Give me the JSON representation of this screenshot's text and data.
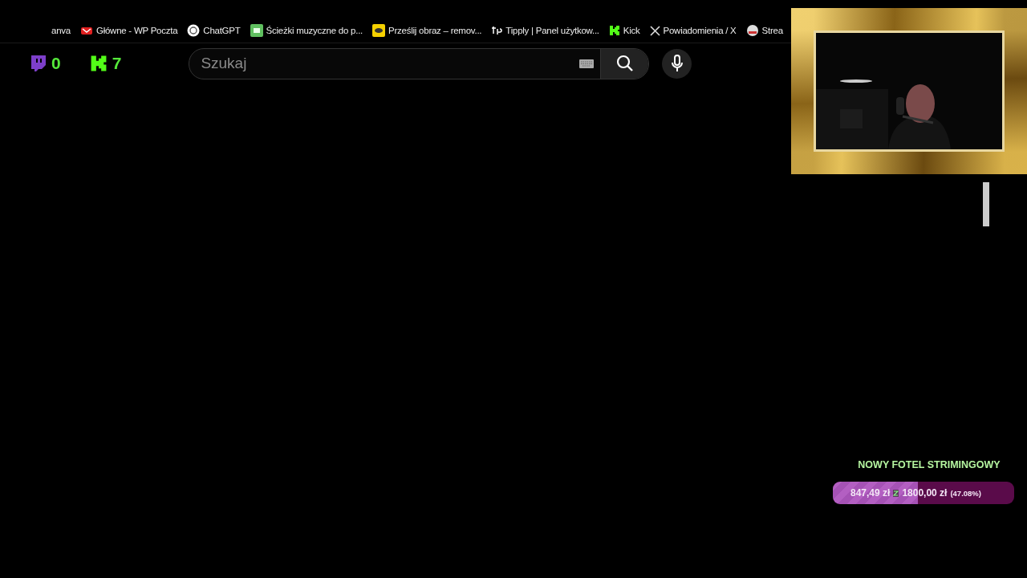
{
  "bookmarks": [
    {
      "label": "anva"
    },
    {
      "label": "Główne - WP Poczta"
    },
    {
      "label": "ChatGPT"
    },
    {
      "label": "Ścieżki muzyczne do p..."
    },
    {
      "label": "Prześlij obraz – remov..."
    },
    {
      "label": "Tipply | Panel użytkow..."
    },
    {
      "label": "Kick"
    },
    {
      "label": "Powiadomienia / X"
    },
    {
      "label": "Strea"
    }
  ],
  "counters": [
    {
      "kind": "twitch",
      "value": "0"
    },
    {
      "kind": "kick",
      "value": "7"
    }
  ],
  "search": {
    "placeholder": "Szukaj"
  },
  "goal": {
    "title": "NOWY FOTEL STRIMINGOWY",
    "current": "847,49 zł",
    "target": "1800,00 zł",
    "percent": "(47.08%)",
    "level": 0.4708
  }
}
